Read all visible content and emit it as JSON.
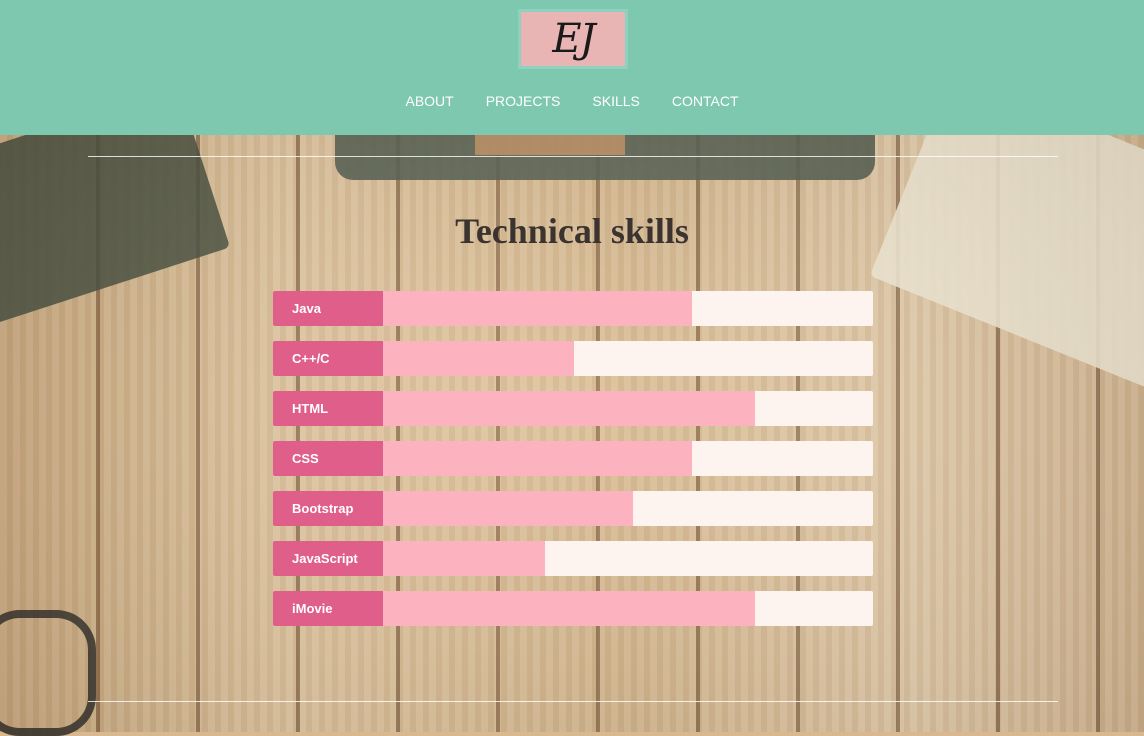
{
  "logo": {
    "text": "EJ"
  },
  "nav": {
    "items": [
      {
        "label": "ABOUT"
      },
      {
        "label": "PROJECTS"
      },
      {
        "label": "SKILLS"
      },
      {
        "label": "CONTACT"
      }
    ]
  },
  "section": {
    "title": "Technical skills"
  },
  "skills": [
    {
      "name": "Java",
      "level": 63
    },
    {
      "name": "C++/C",
      "level": 39
    },
    {
      "name": "HTML",
      "level": 76
    },
    {
      "name": "CSS",
      "level": 63
    },
    {
      "name": "Bootstrap",
      "level": 51
    },
    {
      "name": "JavaScript",
      "level": 33
    },
    {
      "name": "iMovie",
      "level": 76
    }
  ],
  "colors": {
    "header": "#7ec8b0",
    "label": "#e05e8a",
    "fill": "#fcb2bf",
    "track": "#fdf3ef"
  }
}
